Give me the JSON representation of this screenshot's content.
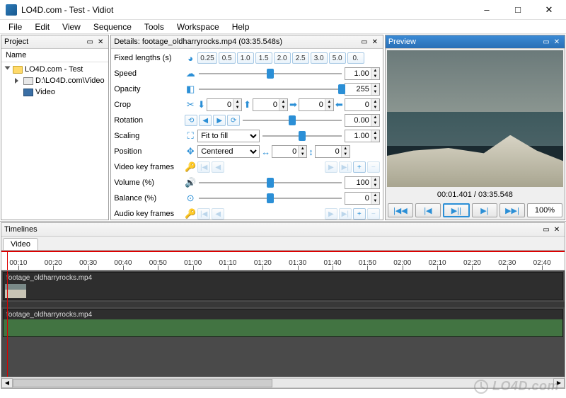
{
  "window": {
    "title": "LO4D.com - Test - Vidiot"
  },
  "menu": {
    "items": [
      "File",
      "Edit",
      "View",
      "Sequence",
      "Tools",
      "Workspace",
      "Help"
    ]
  },
  "project": {
    "title": "Project",
    "col": "Name",
    "root": "LO4D.com - Test",
    "path": "D:\\LO4D.com\\Video",
    "item": "Video"
  },
  "details": {
    "title": "Details: footage_oldharryrocks.mp4 (03:35.548s)",
    "fixed_label": "Fixed lengths (s)",
    "fixed_vals": [
      "0.25",
      "0.5",
      "1.0",
      "1.5",
      "2.0",
      "2.5",
      "3.0",
      "5.0",
      "0."
    ],
    "rows": {
      "speed": {
        "label": "Speed",
        "value": "1.00",
        "thumb": 50
      },
      "opacity": {
        "label": "Opacity",
        "value": "255",
        "thumb": 100
      },
      "crop": {
        "label": "Crop",
        "a": "0",
        "b": "0",
        "c": "0",
        "d": "0"
      },
      "rotation": {
        "label": "Rotation",
        "value": "0.00",
        "thumb": 50
      },
      "scaling": {
        "label": "Scaling",
        "combo": "Fit to fill",
        "value": "1.00",
        "thumb": 50
      },
      "position": {
        "label": "Position",
        "combo": "Centered",
        "a": "0",
        "b": "0"
      },
      "vkf": {
        "label": "Video key frames"
      },
      "volume": {
        "label": "Volume (%)",
        "value": "100",
        "thumb": 50
      },
      "balance": {
        "label": "Balance (%)",
        "value": "0",
        "thumb": 50
      },
      "akf": {
        "label": "Audio key frames"
      }
    }
  },
  "preview": {
    "title": "Preview",
    "time": "00:01.401 / 03:35.548",
    "zoom": "100%"
  },
  "timelines": {
    "title": "Timelines",
    "tab": "Video",
    "ticks": [
      "00:10",
      "00:20",
      "00:30",
      "00:40",
      "00:50",
      "01:00",
      "01:10",
      "01:20",
      "01:30",
      "01:40",
      "01:50",
      "02:00",
      "02:10",
      "02:20",
      "02:30",
      "02:40"
    ],
    "clip1": "footage_oldharryrocks.mp4",
    "clip2": "footage_oldharryrocks.mp4"
  },
  "watermark": "LO4D.com"
}
